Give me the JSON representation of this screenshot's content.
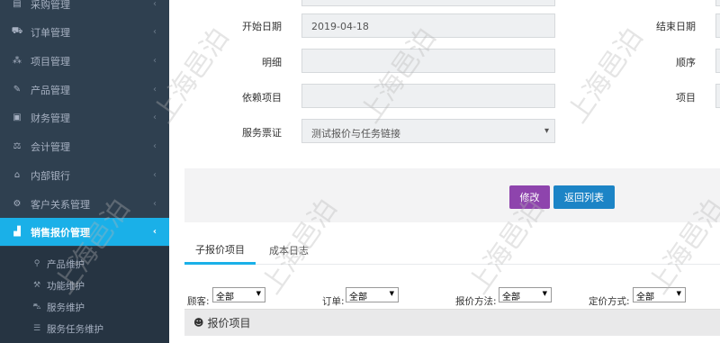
{
  "sidebar": {
    "items": [
      {
        "label": "采购管理",
        "icon": "cart-icon",
        "glyph": "▤"
      },
      {
        "label": "订单管理",
        "icon": "shopping-cart-icon",
        "glyph": "⛟"
      },
      {
        "label": "项目管理",
        "icon": "sitemap-icon",
        "glyph": "⁂"
      },
      {
        "label": "产品管理",
        "icon": "edit-icon",
        "glyph": "✎"
      },
      {
        "label": "财务管理",
        "icon": "money-icon",
        "glyph": "▣"
      },
      {
        "label": "会计管理",
        "icon": "balance-icon",
        "glyph": "⚖"
      },
      {
        "label": "内部银行",
        "icon": "bank-icon",
        "glyph": "⌂"
      },
      {
        "label": "客户关系管理",
        "icon": "gears-icon",
        "glyph": "⚙"
      },
      {
        "label": "销售报价管理",
        "icon": "bar-chart-icon",
        "glyph": "▟"
      }
    ],
    "chevron": "‹",
    "sub_items": [
      {
        "label": "产品维护",
        "icon": "motorcycle-icon",
        "glyph": "⚲"
      },
      {
        "label": "功能维护",
        "icon": "wrench-icon",
        "glyph": "⚒"
      },
      {
        "label": "服务维护",
        "icon": "car-icon",
        "glyph": "⛍"
      },
      {
        "label": "服务任务维护",
        "icon": "list-icon",
        "glyph": "☰"
      }
    ]
  },
  "form": {
    "start_date_label": "开始日期",
    "start_date_value": "2019-04-18",
    "end_date_label": "结束日期",
    "detail_label": "明细",
    "detail_value": "",
    "order_label": "顺序",
    "depends_label": "依赖项目",
    "depends_value": "",
    "project_label": "项目",
    "voucher_label": "服务票证",
    "voucher_value": "测试报价与任务链接"
  },
  "actions": {
    "edit_label": "修改",
    "back_label": "返回列表"
  },
  "tabs": [
    {
      "label": "子报价项目",
      "active": true
    },
    {
      "label": "成本日志",
      "active": false
    }
  ],
  "filters": {
    "customer_label": "顾客:",
    "customer_value": "全部",
    "order_label": "订单:",
    "order_value": "全部",
    "quote_method_label": "报价方法:",
    "quote_method_value": "全部",
    "pricing_label": "定价方式:",
    "pricing_value": "全部"
  },
  "section": {
    "title": "报价项目",
    "icon": "user-icon"
  },
  "watermark": "上海邑泊",
  "colors": {
    "sidebar_bg": "#2f4050",
    "active_item": "#1ab0e8",
    "edit_button": "#8e44ad",
    "back_button": "#1c84c6"
  }
}
